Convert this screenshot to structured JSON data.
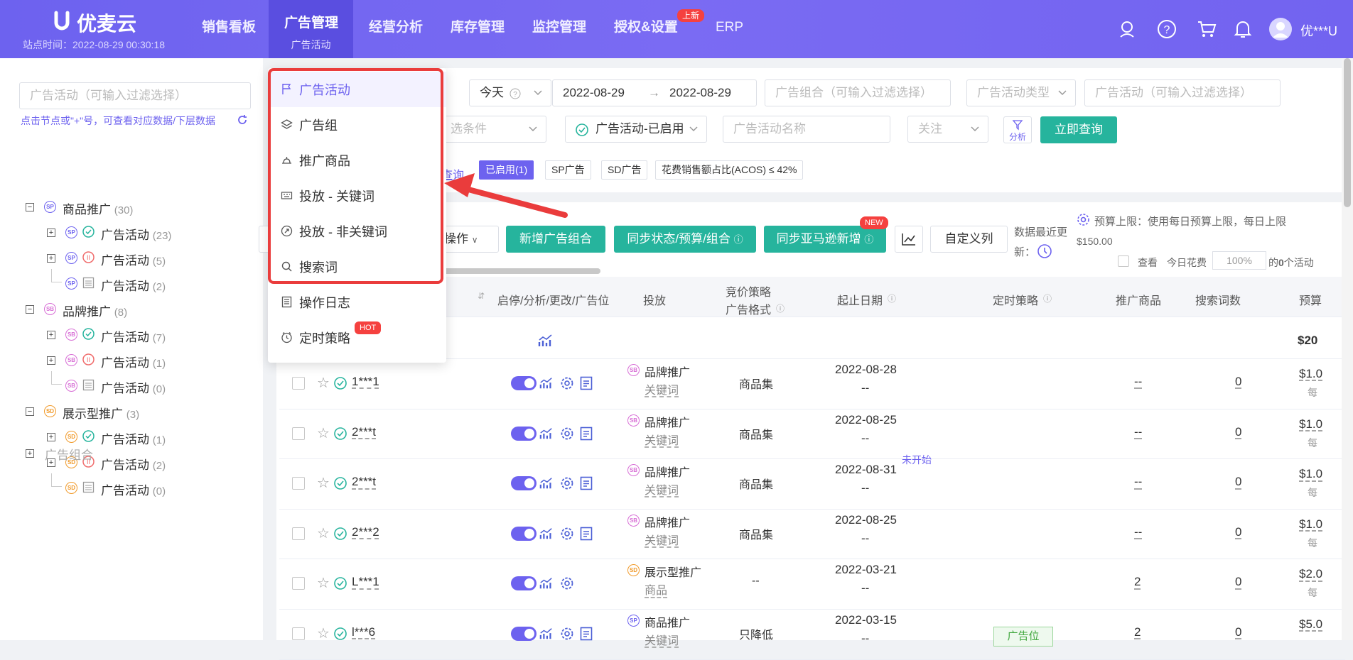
{
  "app": {
    "name": "优麦云",
    "site_time": "站点时间：2022-08-29 00:30:18"
  },
  "nav": {
    "items": [
      "销售看板",
      "广告管理",
      "经营分析",
      "库存管理",
      "监控管理",
      "授权&设置",
      "ERP"
    ],
    "active_sub": "广告活动",
    "badge_new": "上新"
  },
  "user": {
    "name": "优***U"
  },
  "sidebar": {
    "search_placeholder": "广告活动（可输入过滤选择）",
    "hint": "点击节点或\"+\"号，可查看对应数据/下层数据",
    "tree": [
      {
        "label": "商品推广",
        "count": "(30)",
        "level": 0,
        "tag": "SP",
        "children": [
          {
            "label": "广告活动",
            "count": "(23)",
            "status": "enabled"
          },
          {
            "label": "广告活动",
            "count": "(5)",
            "status": "paused"
          },
          {
            "label": "广告活动",
            "count": "(2)",
            "status": "archived"
          }
        ]
      },
      {
        "label": "品牌推广",
        "count": "(8)",
        "level": 0,
        "tag": "SB",
        "children": [
          {
            "label": "广告活动",
            "count": "(7)",
            "status": "enabled"
          },
          {
            "label": "广告活动",
            "count": "(1)",
            "status": "paused"
          },
          {
            "label": "广告活动",
            "count": "(0)",
            "status": "archived"
          }
        ]
      },
      {
        "label": "展示型推广",
        "count": "(3)",
        "level": 0,
        "tag": "SD",
        "children": [
          {
            "label": "广告活动",
            "count": "(1)",
            "status": "enabled"
          },
          {
            "label": "广告活动",
            "count": "(2)",
            "status": "paused"
          },
          {
            "label": "广告活动",
            "count": "(0)",
            "status": "archived"
          }
        ]
      }
    ],
    "ad_group_node": "广告组合"
  },
  "filters": {
    "date_preset": "今天",
    "date_start": "2022-08-29",
    "date_end": "2022-08-29",
    "portfolio_placeholder": "广告组合（可输入过滤选择）",
    "campaign_type_placeholder": "广告活动类型",
    "campaign_filter_placeholder": "广告活动（可输入过滤选择）",
    "condition_placeholder": "选条件",
    "status_select": "广告活动-已启用",
    "campaign_name_placeholder": "广告活动名称",
    "follow_placeholder": "关注",
    "analysis_label": "分析",
    "query_button": "立即查询",
    "saved_query_link": "查询",
    "active_tags": [
      "已启用(1)",
      "SP广告",
      "SD广告",
      "花费销售额占比(ACOS) ≤ 42%"
    ]
  },
  "toolbar": {
    "bulk_ops": "操作",
    "add_portfolio": "新增广告组合",
    "sync_status": "同步状态/预算/组合",
    "sync_amazon": "同步亚马逊新增",
    "new_badge": "NEW",
    "custom_columns": "自定义列",
    "data_updated_line1": "数据最近更",
    "data_updated_line2": "新：",
    "budget_note": "预算上限：使用每日预算上限，每日上限",
    "budget_amount": "$150.00",
    "view_label": "查看",
    "today_spend": "今日花费",
    "percent_value": "100%",
    "active_count_prefix": "的",
    "active_count": "0",
    "active_count_suffix": "个活动"
  },
  "table": {
    "headers": [
      "启停/分析/更改/广告位",
      "投放",
      "竞价策略",
      "广告格式",
      "起止日期",
      "定时策略",
      "推广商品",
      "搜索词数",
      "预算"
    ],
    "total_budget": "$20",
    "rows": [
      {
        "name": "1***1",
        "type": "品牌推广",
        "targeting": "关键词",
        "tag": "SB",
        "format": "商品集",
        "start": "2022-08-28",
        "end": "--",
        "products": "--",
        "terms": "0",
        "budget": "$1.0",
        "budget_sub": "每",
        "note": "",
        "timer": ""
      },
      {
        "name": "2***t",
        "type": "品牌推广",
        "targeting": "关键词",
        "tag": "SB",
        "format": "商品集",
        "start": "2022-08-25",
        "end": "--",
        "products": "--",
        "terms": "0",
        "budget": "$1.0",
        "budget_sub": "每",
        "note": "",
        "timer": ""
      },
      {
        "name": "2***t",
        "type": "品牌推广",
        "targeting": "关键词",
        "tag": "SB",
        "format": "商品集",
        "start": "2022-08-31",
        "end": "--",
        "products": "--",
        "terms": "0",
        "budget": "$1.0",
        "budget_sub": "每",
        "note": "未开始",
        "timer": ""
      },
      {
        "name": "2***2",
        "type": "品牌推广",
        "targeting": "关键词",
        "tag": "SB",
        "format": "商品集",
        "start": "2022-08-25",
        "end": "--",
        "products": "--",
        "terms": "0",
        "budget": "$1.0",
        "budget_sub": "每",
        "note": "",
        "timer": ""
      },
      {
        "name": "L***1",
        "type": "展示型推广",
        "targeting": "商品",
        "tag": "SD",
        "format": "--",
        "start": "2022-03-21",
        "end": "--",
        "products": "2",
        "terms": "0",
        "budget": "$2.0",
        "budget_sub": "每",
        "note": "",
        "timer": ""
      },
      {
        "name": "l***6",
        "type": "商品推广",
        "targeting": "关键词",
        "tag": "SP",
        "format": "只降低",
        "start": "2022-03-15",
        "end": "--",
        "products": "2",
        "terms": "0",
        "budget": "$5.0",
        "budget_sub": "",
        "note": "",
        "timer": "广告位"
      }
    ]
  },
  "dropdown": {
    "items": [
      {
        "label": "广告活动",
        "icon": "flag-icon"
      },
      {
        "label": "广告组",
        "icon": "layers-icon"
      },
      {
        "label": "推广商品",
        "icon": "product-icon"
      },
      {
        "label": "投放 - 关键词",
        "icon": "keyword-icon"
      },
      {
        "label": "投放 - 非关键词",
        "icon": "target-icon"
      },
      {
        "label": "搜索词",
        "icon": "search-icon"
      },
      {
        "label": "操作日志",
        "icon": "log-icon"
      },
      {
        "label": "定时策略",
        "icon": "clock-icon"
      }
    ],
    "hot_badge": "HOT"
  },
  "colors": {
    "brand": "#6d62ef",
    "green": "#26b49d",
    "annotation": "#ea3c3c"
  }
}
